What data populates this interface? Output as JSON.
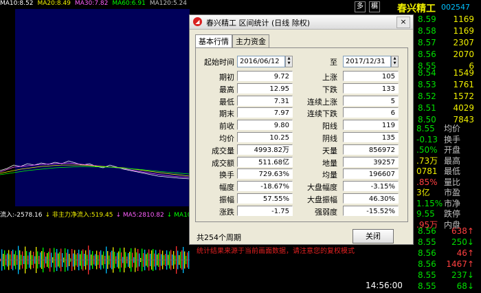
{
  "ma_bar": [
    {
      "text": "MA10:8.52",
      "color": "#ffffff"
    },
    {
      "text": "MA20:8.49",
      "color": "#f0f000"
    },
    {
      "text": "MA30:7.82",
      "color": "#ff60ff"
    },
    {
      "text": "MA60:6.91",
      "color": "#00ff00"
    },
    {
      "text": "MA120:5.24",
      "color": "#c0c0c0"
    }
  ],
  "flow_bar": [
    {
      "text": "流入:-2578.16",
      "color": "#ffffff"
    },
    {
      "text": "↓ 非主力净流入:519.45",
      "color": "#f0f000"
    },
    {
      "text": "↓ MA5:2810.82",
      "color": "#ff60ff"
    },
    {
      "text": "↓ MA10:11",
      "color": "#00ff00"
    }
  ],
  "window": {
    "icon": "多",
    "icon2": "榍"
  },
  "stock": {
    "name": "春兴精工",
    "code": "002547"
  },
  "quotes": [
    {
      "price": "8.59",
      "vol": "1169"
    },
    {
      "price": "8.58",
      "vol": "1169"
    },
    {
      "price": "8.57",
      "vol": "2307"
    },
    {
      "price": "8.56",
      "vol": "2070"
    },
    {
      "price": "8.55",
      "vol": "6"
    },
    {
      "price": "8.54",
      "vol": "1549"
    },
    {
      "price": "8.53",
      "vol": "1761"
    },
    {
      "price": "8.52",
      "vol": "1572"
    },
    {
      "price": "8.51",
      "vol": "4029"
    },
    {
      "price": "8.50",
      "vol": "7843"
    }
  ],
  "stats": [
    {
      "value": "8.55",
      "label": "均价",
      "color": "#00e000"
    },
    {
      "value": "-0.13",
      "label": "换手",
      "color": "#00e000"
    },
    {
      "value": ".50%",
      "label": "开盘",
      "color": "#00e000"
    },
    {
      "value": ".73万",
      "label": "最高",
      "color": "#f0f000"
    },
    {
      "value": "0781",
      "label": "最低",
      "color": "#f0f000"
    },
    {
      "value": ".85%",
      "label": "量比",
      "color": "#ff4040"
    },
    {
      "value": "3亿",
      "label": "市盈",
      "color": "#f0f000"
    },
    {
      "value": "1.15%",
      "label": "市净",
      "color": "#00e000"
    },
    {
      "value": "9.55",
      "label": "跌停",
      "color": "#00e000"
    },
    {
      "value": ".95万",
      "label": "内盘",
      "color": "#ff4040"
    }
  ],
  "ticks": [
    {
      "price": "8.56",
      "vol": "638↑"
    },
    {
      "price": "8.55",
      "vol": "250↓"
    },
    {
      "price": "8.56",
      "vol": "46↑"
    },
    {
      "price": "8.56",
      "vol": "1467↑"
    },
    {
      "price": "8.55",
      "vol": "237↓"
    },
    {
      "price": "8.55",
      "vol": "68↓"
    }
  ],
  "time": "14:56:00",
  "dialog": {
    "title": "春兴精工 区间统计 (日线 除权)",
    "close_glyph": "×",
    "tabs": [
      "基本行情",
      "主力资金"
    ],
    "start_label": "起始时间",
    "start_date": "2016/06/12",
    "to_label": "至",
    "end_date": "2017/12/31",
    "left": [
      {
        "label": "期初",
        "value": "9.72"
      },
      {
        "label": "最高",
        "value": "12.95"
      },
      {
        "label": "最低",
        "value": "7.31"
      },
      {
        "label": "期末",
        "value": "7.97"
      },
      {
        "label": "前收",
        "value": "9.80"
      },
      {
        "label": "均价",
        "value": "10.25"
      },
      {
        "label": "成交量",
        "value": "4993.82万"
      },
      {
        "label": "成交额",
        "value": "511.68亿"
      },
      {
        "label": "换手",
        "value": "729.63%"
      },
      {
        "label": "幅度",
        "value": "-18.67%"
      },
      {
        "label": "振幅",
        "value": "57.55%"
      },
      {
        "label": "涨跌",
        "value": "-1.75"
      }
    ],
    "right": [
      {
        "label": "上涨",
        "value": "105"
      },
      {
        "label": "下跌",
        "value": "133"
      },
      {
        "label": "连续上涨",
        "value": "5"
      },
      {
        "label": "连续下跌",
        "value": "6"
      },
      {
        "label": "阳线",
        "value": "119"
      },
      {
        "label": "阴线",
        "value": "135"
      },
      {
        "label": "天量",
        "value": "856972"
      },
      {
        "label": "地量",
        "value": "39257"
      },
      {
        "label": "均量",
        "value": "196607"
      },
      {
        "label": "大盘幅度",
        "value": "-3.15%"
      },
      {
        "label": "大盘振幅",
        "value": "46.30%"
      },
      {
        "label": "强弱度",
        "value": "-15.52%"
      }
    ],
    "period": "共254个周期",
    "close_button": "关闭",
    "note": "统计结果来源于当前画面数据，请注意您的复权模式"
  }
}
